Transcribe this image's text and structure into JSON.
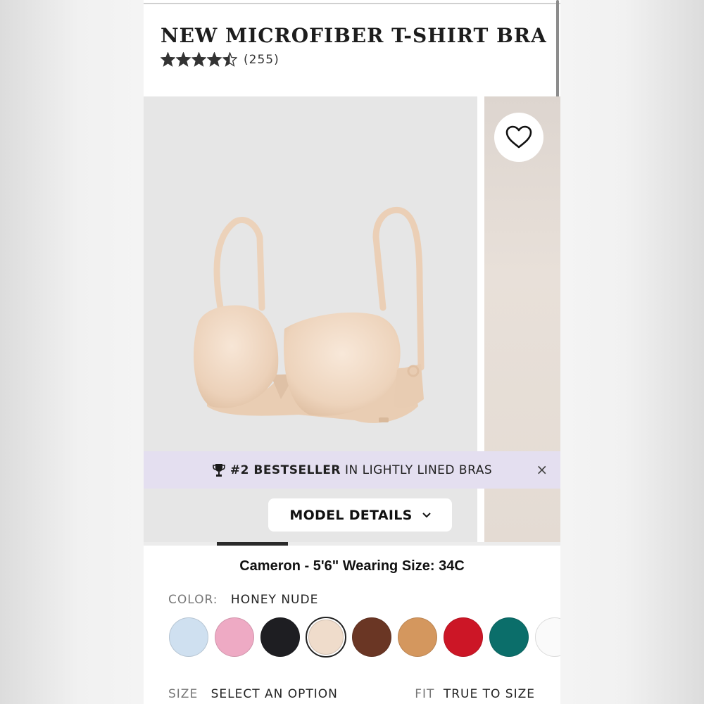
{
  "product": {
    "title": "NEW MICROFIBER T-SHIRT BRA",
    "rating": 4.5,
    "rating_max": 5,
    "rating_count": "(255)"
  },
  "gallery": {
    "heart_icon": "heart-outline-icon",
    "bestseller": {
      "icon": "trophy-icon",
      "rank": "#2 BESTSELLER",
      "category": "IN LIGHTLY LINED BRAS",
      "close_icon": "close-icon",
      "close_glyph": "×"
    },
    "model_details_label": "MODEL DETAILS",
    "chevron_glyph": "⌄",
    "progress": 0.17
  },
  "model_info": "Cameron - 5'6\" Wearing Size: 34C",
  "color": {
    "label": "COLOR:",
    "value": "HONEY NUDE",
    "selected_index": 3,
    "swatches": [
      {
        "name": "light-blue",
        "hex": "#cfe0f0"
      },
      {
        "name": "pink",
        "hex": "#eeaac4"
      },
      {
        "name": "black",
        "hex": "#1e1e22"
      },
      {
        "name": "honey-nude",
        "hex": "#efdccb"
      },
      {
        "name": "brown",
        "hex": "#6a3624"
      },
      {
        "name": "caramel",
        "hex": "#d4975e"
      },
      {
        "name": "red",
        "hex": "#cc1626"
      },
      {
        "name": "teal",
        "hex": "#0b6e6a"
      },
      {
        "name": "white",
        "hex": "#fafafa"
      }
    ]
  },
  "size": {
    "label": "SIZE",
    "value": "SELECT AN OPTION"
  },
  "fit": {
    "label": "FIT",
    "value": "TRUE TO SIZE"
  },
  "colors": {
    "bestseller_bg": "#e4dff0",
    "image_bg": "#e6e6e6",
    "product_tone": "#f2dcc6"
  }
}
